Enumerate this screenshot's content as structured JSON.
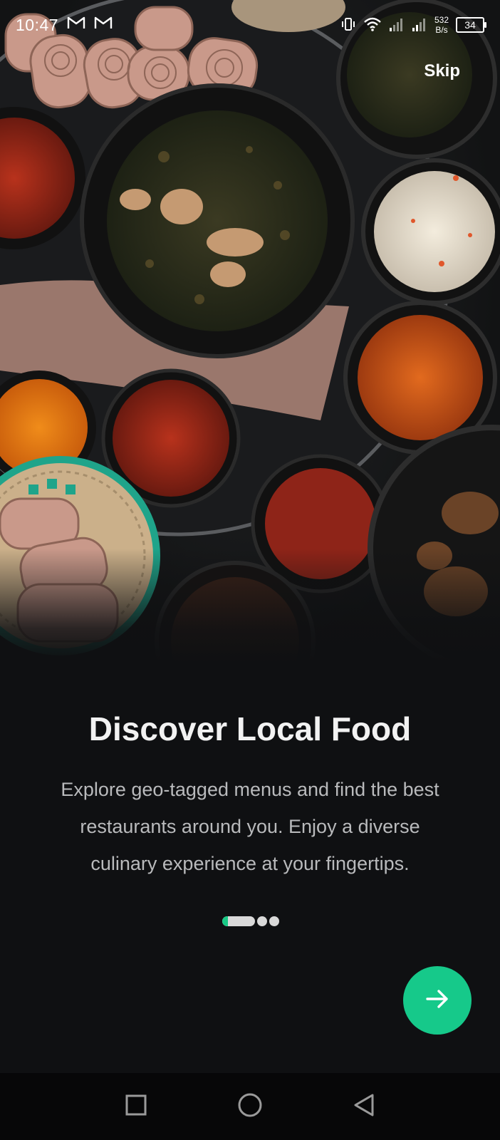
{
  "status_bar": {
    "time": "10:47",
    "net_speed_value": "532",
    "net_speed_unit": "B/s",
    "battery": "34",
    "icons": [
      "gmail-icon",
      "gmail-icon",
      "vibrate-icon",
      "wifi-icon",
      "signal-icon",
      "signal-icon",
      "battery-icon"
    ]
  },
  "header": {
    "skip_label": "Skip"
  },
  "onboarding": {
    "title": "Discover Local Food",
    "description_lines": [
      "Explore geo-tagged menus and find the best",
      "restaurants around you. Enjoy a diverse",
      "culinary experience at your fingertips."
    ],
    "page_count": 3,
    "current_page": 1
  },
  "next_button": {
    "icon": "arrow-right-icon"
  },
  "nav_bar": {
    "icons": [
      "recents-square-icon",
      "home-circle-icon",
      "back-triangle-icon"
    ]
  },
  "colors": {
    "background": "#0f1012",
    "accent": "#16c98a",
    "title_text": "#f2f2f2",
    "description_text": "#b9babc"
  }
}
